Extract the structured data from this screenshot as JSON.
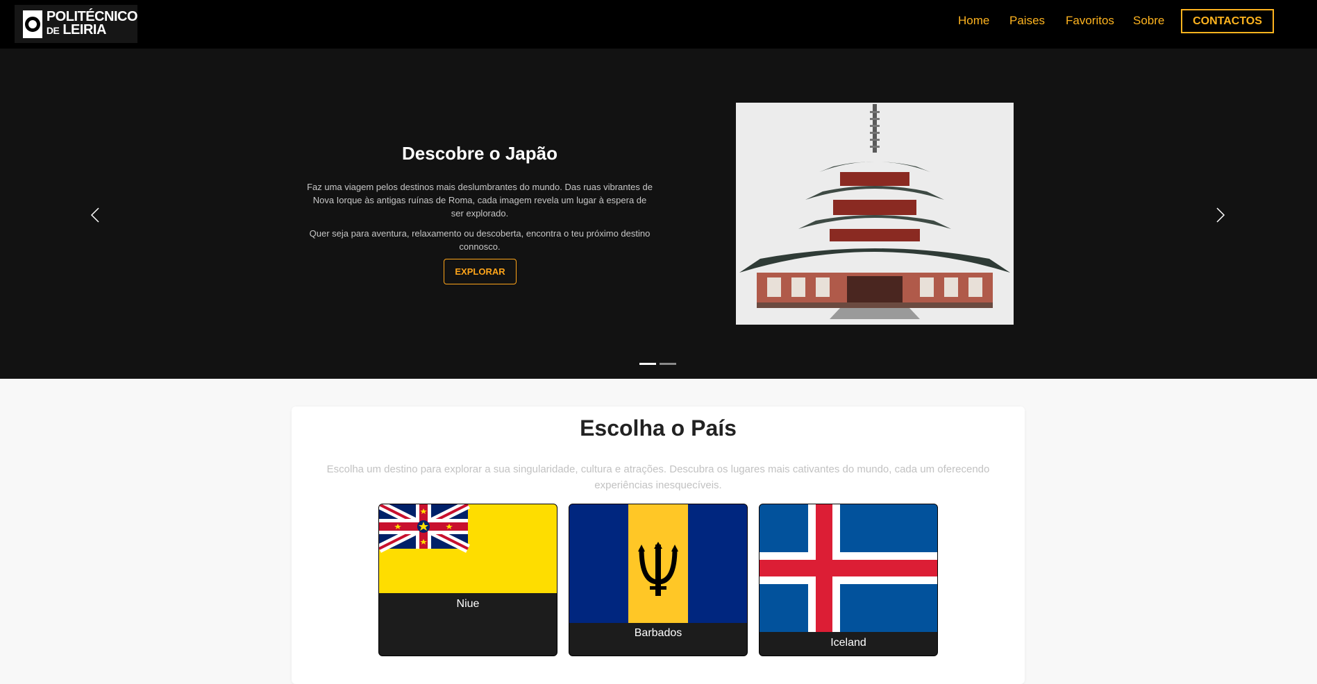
{
  "navbar": {
    "logo": {
      "line1": "POLITÉCNICO",
      "line2a": "DE",
      "line2b": "LEIRIA"
    },
    "links": [
      "Home",
      "Paises",
      "Favoritos",
      "Sobre"
    ],
    "contact_label": "CONTACTOS",
    "accent_color": "#ffb41f"
  },
  "hero": {
    "title": "Descobre o Japão",
    "paragraph1": "Faz uma viagem pelos destinos mais deslumbrantes do mundo. Das ruas vibrantes de Nova Iorque às antigas ruínas de Roma, cada imagem revela um lugar à espera de ser explorado.",
    "paragraph2": "Quer seja para aventura, relaxamento ou descoberta, encontra o teu próximo destino connosco.",
    "button_label": "EXPLORAR",
    "image_icon": "pagoda-image",
    "active_slide": 1,
    "slide_count": 2
  },
  "countries": {
    "title": "Escolha o País",
    "description": "Escolha um destino para explorar a sua singularidade, cultura e atrações. Descubra os lugares mais cativantes do mundo, cada um oferecendo experiências inesquecíveis.",
    "cards": [
      {
        "name": "Niue",
        "flag_icon": "niue-flag"
      },
      {
        "name": "Barbados",
        "flag_icon": "barbados-flag"
      },
      {
        "name": "Iceland",
        "flag_icon": "iceland-flag"
      }
    ]
  }
}
